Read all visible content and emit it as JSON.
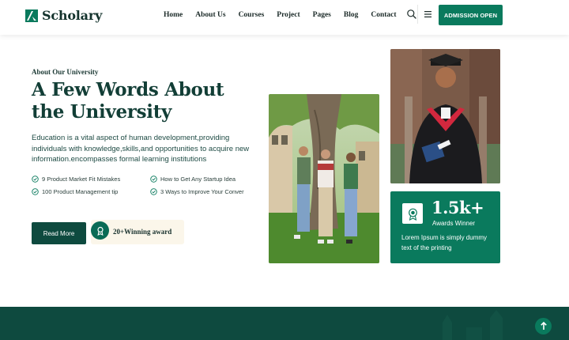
{
  "brand": {
    "name": "Scholary"
  },
  "nav": {
    "links": [
      "Home",
      "About Us",
      "Courses",
      "Project",
      "Pages",
      "Blog",
      "Contact"
    ],
    "cta_label": "ADMISSION OPEN",
    "search_icon": "search-icon",
    "menu_icon": "hamburger-icon"
  },
  "about": {
    "eyebrow": "About Our University",
    "title": "A Few Words About the University",
    "description": "Education is a vital aspect of human development,providing individuals with knowledge,skills,and opportunities to acquire new information.encompasses formal learning institutions",
    "features": [
      "9 Product Market Fit Mistakes",
      "How to Get Any Startup Idea",
      "100 Product Management tip",
      "3 Ways to Improve Your Conver"
    ],
    "read_more_label": "Read More",
    "award_text": "20+Winning award"
  },
  "stat_card": {
    "value": "1.5k+",
    "label": "Awards Winner",
    "description": "Lorem Ipsum is simply dummy text of the printing"
  },
  "colors": {
    "primary": "#0a7a5d",
    "dark": "#0e4a3f",
    "heading": "#123e36",
    "award_bg": "#fbf6ea"
  }
}
